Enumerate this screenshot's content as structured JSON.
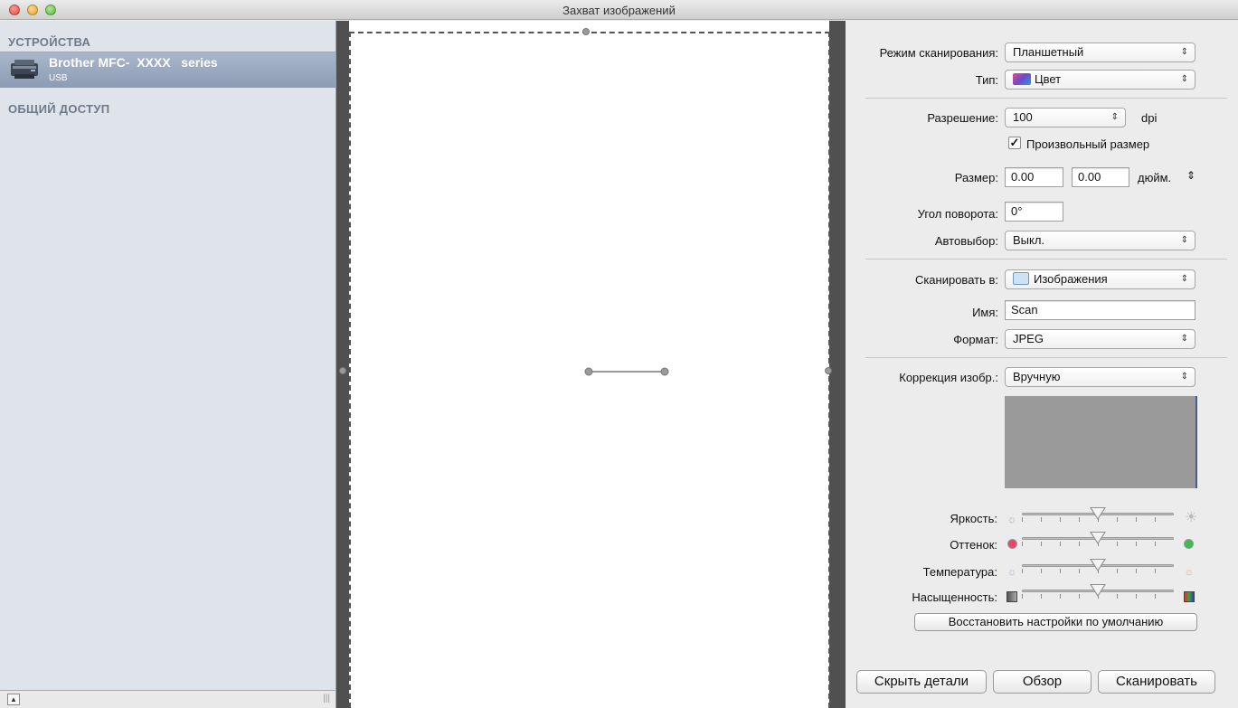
{
  "window": {
    "title": "Захват изображений"
  },
  "sidebar": {
    "devices_header": "УСТРОЙСТВА",
    "shared_header": "ОБЩИЙ ДОСТУП",
    "device": {
      "name": "Brother MFC-  XXXX   series",
      "connection": "USB"
    },
    "footer_grip": "|||"
  },
  "settings": {
    "scan_mode": {
      "label": "Режим сканирования:",
      "value": "Планшетный"
    },
    "kind": {
      "label": "Тип:",
      "value": "Цвет"
    },
    "resolution": {
      "label": "Разрешение:",
      "value": "100",
      "unit": "dpi"
    },
    "custom_size": {
      "label": "Произвольный размер",
      "checked": true
    },
    "size": {
      "label": "Размер:",
      "width": "0.00",
      "height": "0.00",
      "unit": "дюйм."
    },
    "rotation": {
      "label": "Угол поворота:",
      "value": "0°"
    },
    "auto_select": {
      "label": "Автовыбор:",
      "value": "Выкл."
    },
    "scan_to": {
      "label": "Сканировать в:",
      "value": "Изображения"
    },
    "name": {
      "label": "Имя:",
      "value": "Scan"
    },
    "format": {
      "label": "Формат:",
      "value": "JPEG"
    },
    "correction": {
      "label": "Коррекция изобр.:",
      "value": "Вручную"
    }
  },
  "adjustments": {
    "brightness": {
      "label": "Яркость:",
      "level": 0.5
    },
    "tint": {
      "label": "Оттенок:",
      "level": 0.5,
      "left_color": "#e8486e",
      "right_color": "#3dbb53"
    },
    "temperature": {
      "label": "Температура:",
      "level": 0.5
    },
    "saturation": {
      "label": "Насыщенность:",
      "level": 0.5
    },
    "restore_label": "Восстановить настройки по умолчанию"
  },
  "buttons": {
    "hide_details": "Скрыть детали",
    "overview": "Обзор",
    "scan": "Сканировать"
  }
}
